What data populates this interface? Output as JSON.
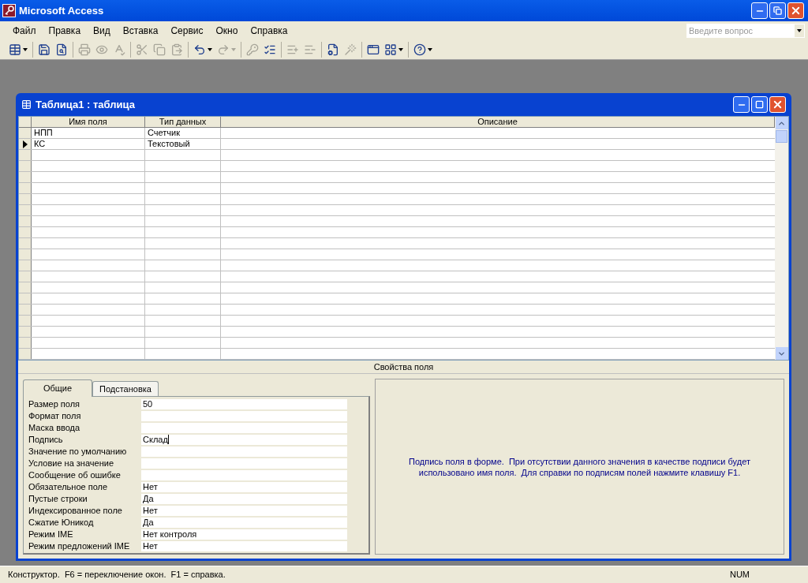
{
  "window": {
    "title": "Microsoft Access"
  },
  "menu": [
    {
      "label": "Файл"
    },
    {
      "label": "Правка"
    },
    {
      "label": "Вид"
    },
    {
      "label": "Вставка"
    },
    {
      "label": "Сервис"
    },
    {
      "label": "Окно"
    },
    {
      "label": "Справка"
    }
  ],
  "question_box": {
    "placeholder": "Введите вопрос"
  },
  "toolbar_groups": [
    {
      "buttons": [
        {
          "kind": "table",
          "disabled": false,
          "dropdown": true
        }
      ]
    },
    {
      "buttons": [
        {
          "kind": "save",
          "disabled": false,
          "dropdown": false
        },
        {
          "kind": "search",
          "disabled": false,
          "dropdown": false
        }
      ]
    },
    {
      "buttons": [
        {
          "kind": "print",
          "disabled": true,
          "dropdown": false
        },
        {
          "kind": "preview",
          "disabled": true,
          "dropdown": false
        },
        {
          "kind": "spell",
          "disabled": true,
          "dropdown": false
        }
      ]
    },
    {
      "buttons": [
        {
          "kind": "cut",
          "disabled": true,
          "dropdown": false
        },
        {
          "kind": "copy",
          "disabled": true,
          "dropdown": false
        },
        {
          "kind": "paste",
          "disabled": true,
          "dropdown": false
        }
      ]
    },
    {
      "buttons": [
        {
          "kind": "undo",
          "disabled": false,
          "dropdown": true
        },
        {
          "kind": "redo",
          "disabled": true,
          "dropdown": true
        }
      ]
    },
    {
      "buttons": [
        {
          "kind": "key",
          "disabled": true,
          "dropdown": false
        },
        {
          "kind": "indexes",
          "disabled": false,
          "dropdown": false
        }
      ]
    },
    {
      "buttons": [
        {
          "kind": "insert",
          "disabled": true,
          "dropdown": false
        },
        {
          "kind": "delete",
          "disabled": true,
          "dropdown": false
        }
      ]
    },
    {
      "buttons": [
        {
          "kind": "properties",
          "disabled": false,
          "dropdown": false
        },
        {
          "kind": "build",
          "disabled": true,
          "dropdown": false
        }
      ]
    },
    {
      "buttons": [
        {
          "kind": "database",
          "disabled": false,
          "dropdown": false
        },
        {
          "kind": "newobject",
          "disabled": false,
          "dropdown": true
        }
      ]
    },
    {
      "buttons": [
        {
          "kind": "help",
          "disabled": false,
          "dropdown": true
        }
      ]
    }
  ],
  "table_window": {
    "title": "Таблица1 : таблица"
  },
  "table": {
    "columns": [
      "Имя поля",
      "Тип данных",
      "Описание"
    ],
    "rows": [
      {
        "name": "НПП",
        "type": "Счетчик",
        "selected": false
      },
      {
        "name": "КС",
        "type": "Текстовый",
        "selected": true
      }
    ]
  },
  "properties": {
    "title": "Свойства поля",
    "tabs": [
      {
        "label": "Общие",
        "selected": true
      },
      {
        "label": "Подстановка",
        "selected": false
      }
    ],
    "rows": [
      {
        "label": "Размер поля",
        "value": "50",
        "focused": false
      },
      {
        "label": "Формат поля",
        "focused": false
      },
      {
        "label": "Маска ввода",
        "focused": false
      },
      {
        "label": "Подпись",
        "value": "Склад",
        "focused": true
      },
      {
        "label": "Значение по умолчанию",
        "focused": false
      },
      {
        "label": "Условие на значение",
        "focused": false
      },
      {
        "label": "Сообщение об ошибке",
        "focused": false
      },
      {
        "label": "Обязательное поле",
        "value": "Нет",
        "focused": false
      },
      {
        "label": "Пустые строки",
        "value": "Да",
        "focused": false
      },
      {
        "label": "Индексированное поле",
        "value": "Нет",
        "focused": false
      },
      {
        "label": "Сжатие Юникод",
        "value": "Да",
        "focused": false
      },
      {
        "label": "Режим IME",
        "value": "Нет контроля",
        "focused": false
      },
      {
        "label": "Режим предложений IME",
        "value": "Нет",
        "focused": false
      }
    ],
    "hint": "Подпись поля в форме.  При отсутствии данного значения в качестве подписи будет использовано имя поля.  Для справки по подписям полей нажмите клавишу F1."
  },
  "status_bar": {
    "message": "Конструктор.  F6 = переключение окон.  F1 = справка.",
    "indicator": "NUM"
  }
}
